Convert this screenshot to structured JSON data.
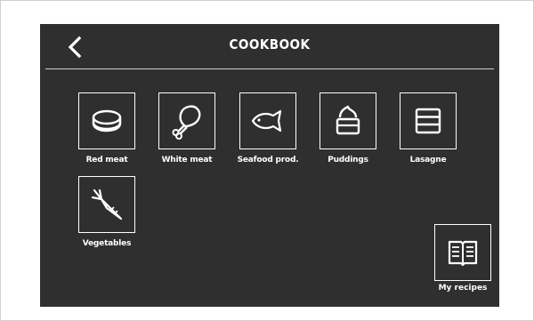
{
  "app": {
    "title": "COOKBOOK",
    "colors": {
      "screen_background": "#2f2f2f",
      "foreground": "#ffffff",
      "divider": "#cfcfcf"
    }
  },
  "header": {
    "back_icon": "chevron-left-icon"
  },
  "categories": [
    {
      "label": "Red meat",
      "icon": "steak-icon"
    },
    {
      "label": "White meat",
      "icon": "chicken-leg-icon"
    },
    {
      "label": "Seafood prod.",
      "icon": "fish-icon"
    },
    {
      "label": "Puddings",
      "icon": "pudding-icon"
    },
    {
      "label": "Lasagne",
      "icon": "lasagne-layers-icon"
    },
    {
      "label": "Vegetables",
      "icon": "carrot-icon"
    }
  ],
  "my_recipes": {
    "label": "My recipes",
    "icon": "open-book-icon"
  }
}
